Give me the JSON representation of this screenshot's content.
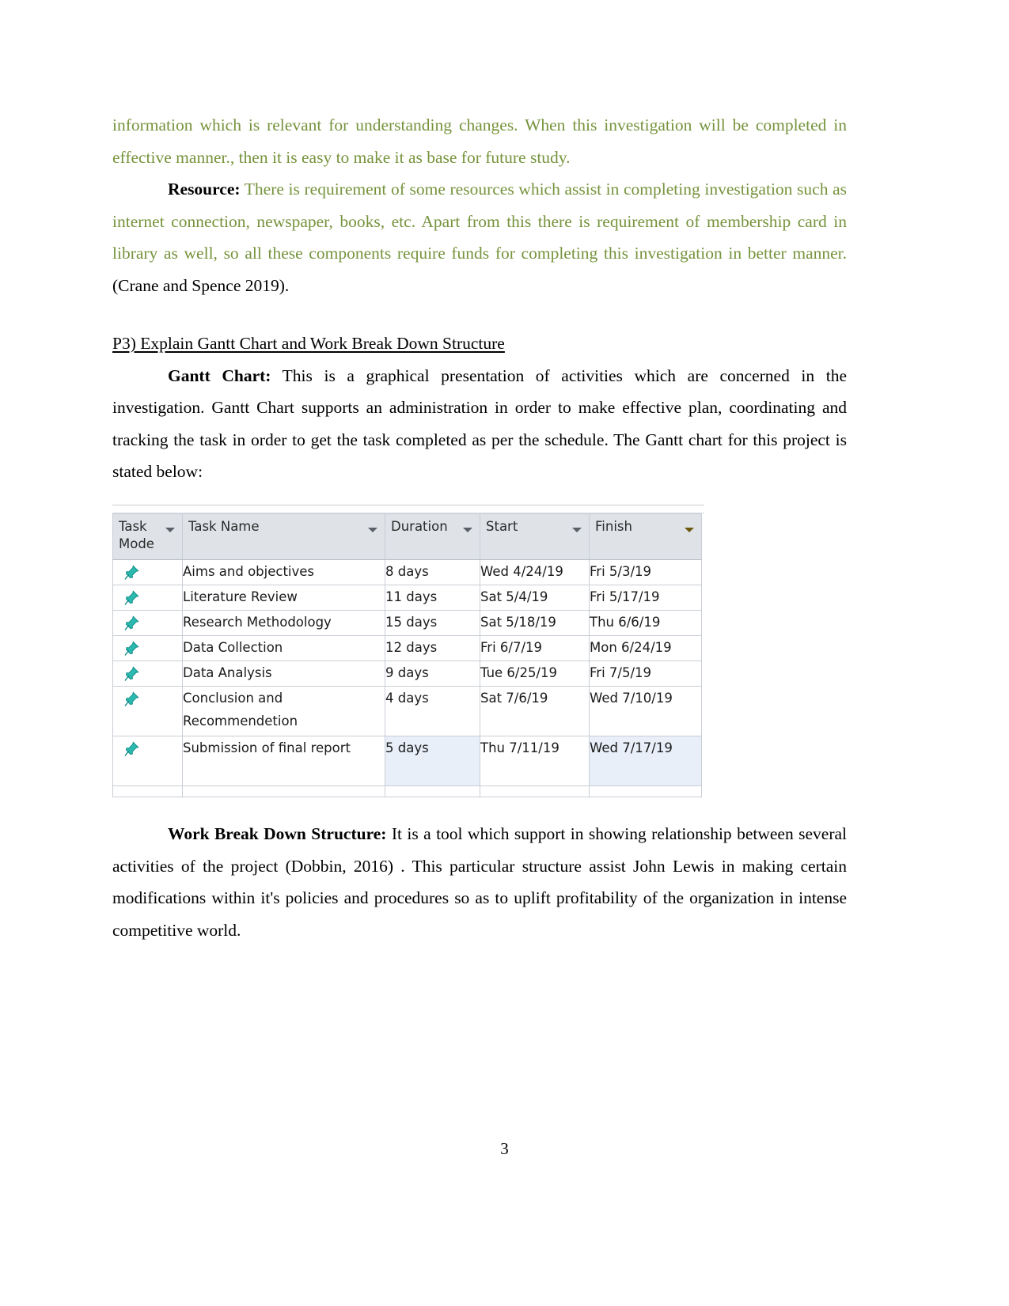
{
  "document": {
    "page_number": "3",
    "colors": {
      "green_text": "#76933c",
      "header_yellow": "#ffd766",
      "header_grey": "#dfe3e8",
      "row_highlight_blue": "#e8eff9",
      "pin_teal": "#2bb9b0"
    }
  },
  "paragraphs": {
    "p1_green": "information which is relevant for understanding changes. When this investigation will be completed in effective manner., then it is easy to make it as base for future study.",
    "p2_label": "Resource:",
    "p2_green": "There is requirement of some resources which assist in completing investigation such as internet connection, newspaper, books, etc. Apart from this there is requirement of membership card in library as well, so all these components require funds for completing this investigation in better manner.",
    "p2_citation": "(Crane and Spence  2019).",
    "heading": "P3) Explain Gantt Chart and Work Break Down Structure",
    "p3_label": "Gantt Chart:",
    "p3_body": "This is a  graphical presentation of activities which are concerned in the investigation. Gantt Chart supports an administration in order to make effective plan, coordinating and tracking the task in order to get the task completed as per the schedule. The Gantt chart for  this project is stated below:",
    "p4_label": "Work Break Down Structure:",
    "p4_body": "It is a tool which support in showing relationship between several activities of the project (Dobbin,  2016) . This particular  structure assist John Lewis in making certain modifications within it's policies and procedures so as to uplift profitability of the organization in intense competitive world."
  },
  "gantt": {
    "columns": [
      {
        "label": "Task Mode",
        "has_sort_caret": true,
        "highlighted": false
      },
      {
        "label": "Task Name",
        "has_sort_caret": true,
        "highlighted": false
      },
      {
        "label": "Duration",
        "has_sort_caret": true,
        "highlighted": false
      },
      {
        "label": "Start",
        "has_sort_caret": true,
        "highlighted": false
      },
      {
        "label": "Finish",
        "has_sort_caret": true,
        "highlighted": true
      }
    ],
    "rows": [
      {
        "mode_icon": "pin-icon",
        "task_name": "Aims and objectives",
        "duration": "8 days",
        "start": "Wed 4/24/19",
        "finish": "Fri 5/3/19"
      },
      {
        "mode_icon": "pin-icon",
        "task_name": "Literature Review",
        "duration": "11 days",
        "start": "Sat 5/4/19",
        "finish": "Fri 5/17/19"
      },
      {
        "mode_icon": "pin-icon",
        "task_name": "Research Methodology",
        "duration": "15 days",
        "start": "Sat 5/18/19",
        "finish": "Thu 6/6/19"
      },
      {
        "mode_icon": "pin-icon",
        "task_name": "Data Collection",
        "duration": "12 days",
        "start": "Fri 6/7/19",
        "finish": "Mon 6/24/19"
      },
      {
        "mode_icon": "pin-icon",
        "task_name": "Data Analysis",
        "duration": "9 days",
        "start": "Tue 6/25/19",
        "finish": "Fri 7/5/19"
      },
      {
        "mode_icon": "pin-icon",
        "task_name": "Conclusion and Recommendetion",
        "duration": "4 days",
        "start": "Sat 7/6/19",
        "finish": "Wed 7/10/19"
      },
      {
        "mode_icon": "pin-icon",
        "task_name": "Submission of final report",
        "duration": "5 days",
        "start": "Thu 7/11/19",
        "finish": "Wed 7/17/19"
      }
    ]
  }
}
